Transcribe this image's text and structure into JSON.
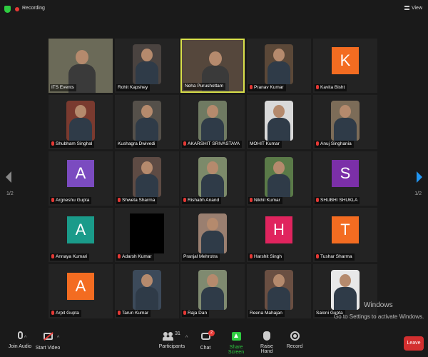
{
  "topbar": {
    "recording_label": "Recording",
    "view_label": "View"
  },
  "pagination": {
    "left": "1/2",
    "right": "1/2"
  },
  "participants": [
    {
      "name": "ITS Events",
      "muted": false,
      "kind": "video",
      "bg": "#6b6a58",
      "speaker": false
    },
    {
      "name": "Rohit Kapshey",
      "muted": false,
      "kind": "video",
      "bg": "#4a4340",
      "speaker": false
    },
    {
      "name": "Neha Purushottam",
      "muted": false,
      "kind": "video",
      "bg": "#55473c",
      "speaker": true
    },
    {
      "name": "Pranav Kumar",
      "muted": true,
      "kind": "video",
      "bg": "#5b4838",
      "speaker": false
    },
    {
      "name": "Kavita Bisht",
      "muted": true,
      "kind": "avatar",
      "letter": "K",
      "color": "#f36c21",
      "speaker": false
    },
    {
      "name": "Shubham Singhal",
      "muted": true,
      "kind": "video",
      "bg": "#7a3a2f",
      "speaker": false
    },
    {
      "name": "Kushagra Dwivedi",
      "muted": false,
      "kind": "video",
      "bg": "#55504a",
      "speaker": false
    },
    {
      "name": "AKARSHIT SRIVASTAVA",
      "muted": true,
      "kind": "video",
      "bg": "#6f7a62",
      "speaker": false
    },
    {
      "name": "MOHIT Kumar",
      "muted": false,
      "kind": "video",
      "bg": "#d9d9d9",
      "speaker": false
    },
    {
      "name": "Anuj Singhania",
      "muted": true,
      "kind": "video",
      "bg": "#7c6c58",
      "speaker": false
    },
    {
      "name": "Argneshu Gupta",
      "muted": true,
      "kind": "avatar",
      "letter": "A",
      "color": "#7b4bc0",
      "speaker": false
    },
    {
      "name": "Shweta Sharma",
      "muted": true,
      "kind": "video",
      "bg": "#5e4b44",
      "speaker": false
    },
    {
      "name": "Rishabh Anand",
      "muted": true,
      "kind": "video",
      "bg": "#7c8a6a",
      "speaker": false
    },
    {
      "name": "Nikhil Kumar",
      "muted": true,
      "kind": "video",
      "bg": "#5a7a48",
      "speaker": false
    },
    {
      "name": "SHUBHI SHUKLA",
      "muted": true,
      "kind": "avatar",
      "letter": "S",
      "color": "#7b2fa8",
      "speaker": false
    },
    {
      "name": "Annaya Kumari",
      "muted": true,
      "kind": "avatar",
      "letter": "A",
      "color": "#1a9b8a",
      "speaker": false
    },
    {
      "name": "Adarsh Kumar",
      "muted": true,
      "kind": "black",
      "speaker": false
    },
    {
      "name": "Pranjal Mehrotra",
      "muted": false,
      "kind": "video",
      "bg": "#9a7f70",
      "speaker": false
    },
    {
      "name": "Harshit Singh",
      "muted": true,
      "kind": "avatar",
      "letter": "H",
      "color": "#e0245e",
      "speaker": false
    },
    {
      "name": "Tushar Sharma",
      "muted": true,
      "kind": "avatar",
      "letter": "T",
      "color": "#f36c21",
      "speaker": false
    },
    {
      "name": "Arpit Gupta",
      "muted": true,
      "kind": "avatar",
      "letter": "A",
      "color": "#f36c21",
      "speaker": false
    },
    {
      "name": "Tarun Kumar",
      "muted": true,
      "kind": "video",
      "bg": "#3c4a5a",
      "speaker": false
    },
    {
      "name": "Raja Dan",
      "muted": true,
      "kind": "video",
      "bg": "#7f8a70",
      "speaker": false
    },
    {
      "name": "Reena Mahajan",
      "muted": false,
      "kind": "video",
      "bg": "#6a4f42",
      "speaker": false
    },
    {
      "name": "Saloni Gupta",
      "muted": false,
      "kind": "video",
      "bg": "#e8e8e8",
      "speaker": false
    }
  ],
  "watermark": {
    "title": "Windows",
    "subtitle": "Go to Settings to activate Windows."
  },
  "toolbar": {
    "join_audio": "Join Audio",
    "start_video": "Start Video",
    "participants_label": "Participants",
    "participants_count": "31",
    "chat_label": "Chat",
    "chat_badge": "2",
    "share_label": "Share Screen",
    "raise_hand_label": "Raise Hand",
    "record_label": "Record",
    "leave_label": "Leave"
  },
  "colors": {
    "speaker_border": "#d9e04a",
    "share_green": "#2ecc40",
    "leave_red": "#d32f2f",
    "next_arrow": "#2196f3"
  }
}
